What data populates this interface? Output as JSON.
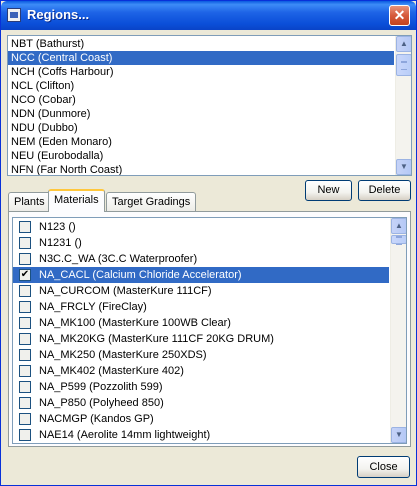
{
  "window": {
    "title": "Regions..."
  },
  "regions": {
    "items": [
      {
        "label": "NBT (Bathurst)",
        "selected": false
      },
      {
        "label": "NCC (Central Coast)",
        "selected": true
      },
      {
        "label": "NCH (Coffs Harbour)",
        "selected": false
      },
      {
        "label": "NCL (Clifton)",
        "selected": false
      },
      {
        "label": "NCO (Cobar)",
        "selected": false
      },
      {
        "label": "NDN (Dunmore)",
        "selected": false
      },
      {
        "label": "NDU (Dubbo)",
        "selected": false
      },
      {
        "label": "NEM (Eden Monaro)",
        "selected": false
      },
      {
        "label": "NEU (Eurobodalla)",
        "selected": false
      },
      {
        "label": "NFN (Far North Coast)",
        "selected": false
      }
    ]
  },
  "buttons": {
    "new_label": "New",
    "delete_label": "Delete",
    "close_label": "Close"
  },
  "tabs": [
    {
      "label": "Plants",
      "active": false
    },
    {
      "label": "Materials",
      "active": true
    },
    {
      "label": "Target Gradings",
      "active": false
    }
  ],
  "materials": {
    "items": [
      {
        "label": "N123 ()",
        "checked": false,
        "selected": false
      },
      {
        "label": "N1231 ()",
        "checked": false,
        "selected": false
      },
      {
        "label": "N3C.C_WA (3C.C Waterproofer)",
        "checked": false,
        "selected": false
      },
      {
        "label": "NA_CACL (Calcium Chloride Accelerator)",
        "checked": true,
        "selected": true
      },
      {
        "label": "NA_CURCOM (MasterKure 111CF)",
        "checked": false,
        "selected": false
      },
      {
        "label": "NA_FRCLY (FireClay)",
        "checked": false,
        "selected": false
      },
      {
        "label": "NA_MK100 (MasterKure 100WB Clear)",
        "checked": false,
        "selected": false
      },
      {
        "label": "NA_MK20KG (MasterKure 111CF 20KG DRUM)",
        "checked": false,
        "selected": false
      },
      {
        "label": "NA_MK250 (MasterKure 250XDS)",
        "checked": false,
        "selected": false
      },
      {
        "label": "NA_MK402 (MasterKure 402)",
        "checked": false,
        "selected": false
      },
      {
        "label": "NA_P599 (Pozzolith 599)",
        "checked": false,
        "selected": false
      },
      {
        "label": "NA_P850 (Polyheed 850)",
        "checked": false,
        "selected": false
      },
      {
        "label": "NACMGP (Kandos GP)",
        "checked": false,
        "selected": false
      },
      {
        "label": "NAE14 (Aerolite 14mm lightweight)",
        "checked": false,
        "selected": false
      }
    ]
  },
  "icons": {
    "window": "window-app-icon",
    "close": "close-icon",
    "scroll_up": "chevron-up-icon",
    "scroll_down": "chevron-down-icon",
    "check": "checkmark-icon"
  },
  "colors": {
    "selection": "#316ac5",
    "titlebar": "#0a4ed8",
    "dialog_bg": "#ece9d8"
  }
}
